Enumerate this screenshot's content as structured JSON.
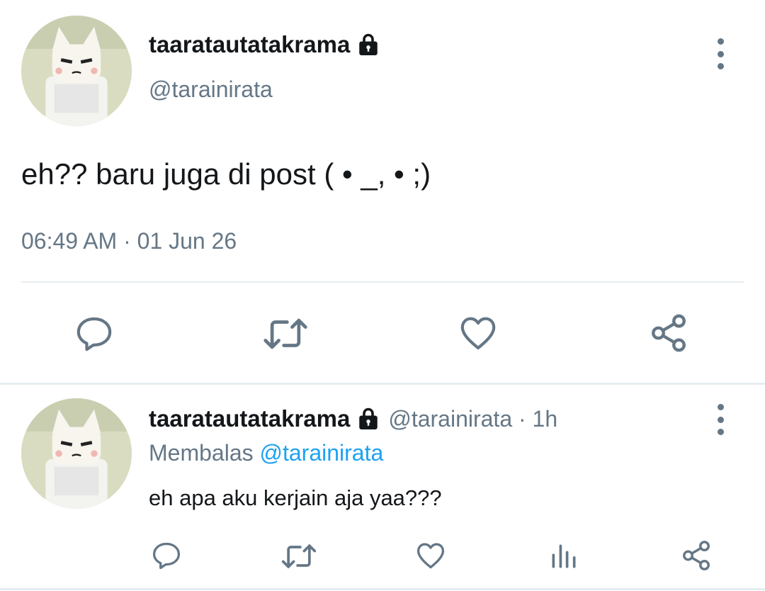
{
  "main_tweet": {
    "display_name": "taaratautatakrama",
    "handle": "@tarainirata",
    "text": "eh?? baru juga di post ( • _, • ;)",
    "timestamp": "06:49 AM · 01 Jun 26",
    "avatar_icon": "cat-mask-avatar",
    "lock_icon": "lock-icon",
    "more_icon": "more-vertical-icon",
    "actions": [
      "reply-icon",
      "retweet-icon",
      "like-icon",
      "share-icon"
    ]
  },
  "reply_tweet": {
    "display_name": "taaratautatakrama",
    "meta": "@tarainirata · 1h",
    "replying_prefix": "Membalas",
    "replying_to": "@tarainirata",
    "text": "eh apa aku kerjain aja yaa???",
    "avatar_icon": "cat-mask-avatar",
    "lock_icon": "lock-icon",
    "more_icon": "more-vertical-icon",
    "actions": [
      "reply-icon",
      "retweet-icon",
      "like-icon",
      "analytics-icon",
      "share-icon"
    ]
  },
  "colors": {
    "text": "#14171a",
    "secondary": "#657786",
    "link": "#1da1f2",
    "divider": "#e6ecf0"
  }
}
